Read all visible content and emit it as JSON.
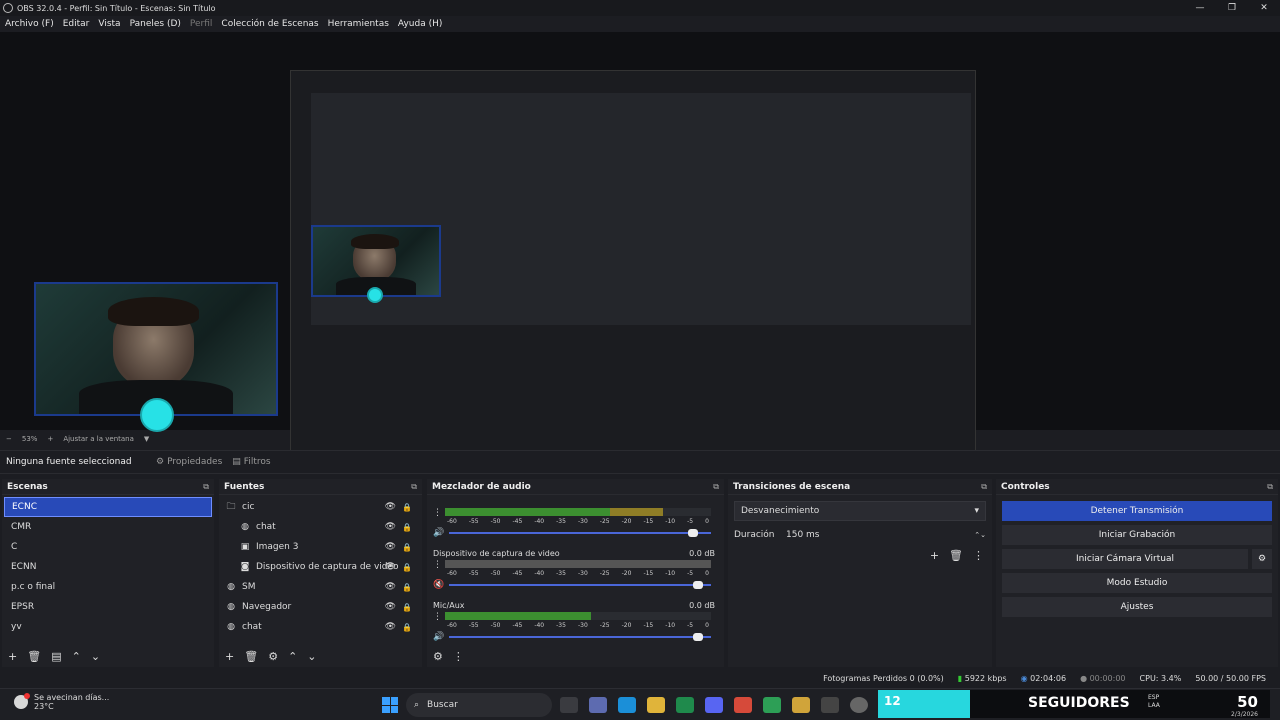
{
  "window": {
    "title": "OBS 32.0.4 - Perfil: Sin Título - Escenas: Sin Título",
    "buttons": [
      "—",
      "❐",
      "✕"
    ]
  },
  "menu": [
    {
      "label": "Archivo (F)",
      "disabled": false
    },
    {
      "label": "Editar",
      "disabled": false
    },
    {
      "label": "Vista",
      "disabled": false
    },
    {
      "label": "Paneles (D)",
      "disabled": false
    },
    {
      "label": "Perfil",
      "disabled": true
    },
    {
      "label": "Colección de Escenas",
      "disabled": false
    },
    {
      "label": "Herramientas",
      "disabled": false
    },
    {
      "label": "Ayuda (H)",
      "disabled": false
    }
  ],
  "zoom": {
    "minus": "−",
    "value": "53%",
    "plus": "+",
    "fit": "Ajustar a la ventana",
    "caret": "▼"
  },
  "source_bar": {
    "no_source": "Ninguna fuente seleccionad",
    "properties": "Propiedades",
    "filters": "Filtros"
  },
  "scenes": {
    "title": "Escenas",
    "items": [
      "ECNC",
      "CMR",
      "C",
      "ECNN",
      "p.c o final",
      "EPSR",
      "yv"
    ],
    "selected": 0
  },
  "sources": {
    "title": "Fuentes",
    "items": [
      {
        "name": "cic",
        "icon": "folder-icon",
        "indent": 0
      },
      {
        "name": "chat",
        "icon": "globe-icon",
        "indent": 1
      },
      {
        "name": "Imagen 3",
        "icon": "image-icon",
        "indent": 1
      },
      {
        "name": "Dispositivo de captura de video",
        "icon": "camera-icon",
        "indent": 1
      },
      {
        "name": "SM",
        "icon": "globe-icon",
        "indent": 0
      },
      {
        "name": "Navegador",
        "icon": "globe-icon",
        "indent": 0
      },
      {
        "name": "chat",
        "icon": "globe-icon",
        "indent": 0
      }
    ]
  },
  "mixer": {
    "title": "Mezclador de audio",
    "scale": [
      "-60",
      "-55",
      "-50",
      "-45",
      "-40",
      "-35",
      "-30",
      "-25",
      "-20",
      "-15",
      "-10",
      "-5",
      "0"
    ],
    "channels": [
      {
        "name": "",
        "db": "",
        "level": 0.82,
        "fader": 0.95,
        "muted": false
      },
      {
        "name": "Dispositivo de captura de video",
        "db": "0.0 dB",
        "level": 0.0,
        "fader": 0.97,
        "muted": true
      },
      {
        "name": "Mic/Aux",
        "db": "0.0 dB",
        "level": 0.55,
        "fader": 0.97,
        "muted": false
      }
    ]
  },
  "transitions": {
    "title": "Transiciones de escena",
    "selected": "Desvanecimiento",
    "duration_label": "Duración",
    "duration_value": "150 ms"
  },
  "controls": {
    "title": "Controles",
    "buttons": [
      "Detener Transmisión",
      "Iniciar Grabación",
      "Iniciar Cámara Virtual",
      "Modo Estudio",
      "Ajustes"
    ]
  },
  "status": {
    "dropped": "Fotogramas Perdidos 0 (0.0%)",
    "bitrate": "5922 kbps",
    "stream_time": "02:04:06",
    "rec_time": "00:00:00",
    "cpu": "CPU: 3.4%",
    "fps": "50.00 / 50.00 FPS"
  },
  "taskbar": {
    "weather_text": "Se avecinan días...",
    "weather_temp": "23°C",
    "search": "Buscar",
    "followers_count": "12",
    "followers_label": "SEGUIDORES",
    "lang1": "ESP",
    "lang2": "LAA",
    "clock": "50",
    "date": "2/3/2026"
  },
  "colors": {
    "accent": "#284ab8",
    "teal": "#27d7de"
  }
}
